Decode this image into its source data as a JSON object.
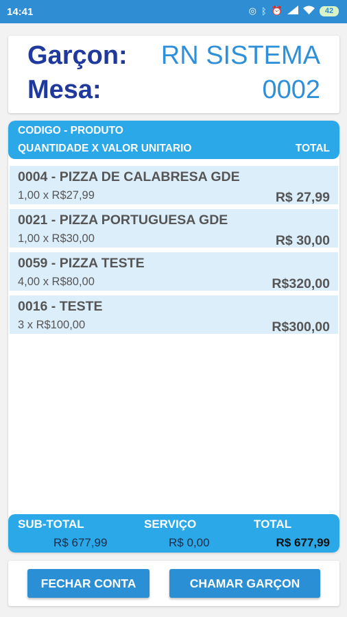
{
  "status_bar": {
    "time": "14:41",
    "icons": [
      "alarm-icon",
      "bluetooth-icon",
      "clock-icon",
      "signal-icon",
      "wifi-icon"
    ],
    "battery": "42"
  },
  "header": {
    "waiter_label": "Garçon:",
    "waiter_value": "RN SISTEMA",
    "table_label": "Mesa:",
    "table_value": "0002"
  },
  "list_header": {
    "line1": "CODIGO - PRODUTO",
    "line2": "QUANTIDADE X VALOR UNITARIO",
    "total": "TOTAL"
  },
  "items": [
    {
      "name": "0004 - PIZZA DE CALABRESA GDE",
      "qty": "1,00  x  R$27,99",
      "total": "R$ 27,99"
    },
    {
      "name": "0021 - PIZZA PORTUGUESA GDE",
      "qty": "1,00  x  R$30,00",
      "total": "R$ 30,00"
    },
    {
      "name": "0059 - PIZZA TESTE",
      "qty": "4,00  x  R$80,00",
      "total": "R$320,00"
    },
    {
      "name": "0016 - TESTE",
      "qty": "3  x  R$100,00",
      "total": "R$300,00"
    }
  ],
  "totals": {
    "subtotal_label": "SUB-TOTAL",
    "subtotal_value": "R$ 677,99",
    "service_label": "SERVIÇO",
    "service_value": "R$ 0,00",
    "total_label": "TOTAL",
    "total_value": "R$ 677,99"
  },
  "buttons": {
    "close_account": "FECHAR CONTA",
    "call_waiter": "CHAMAR GARÇON"
  },
  "colors": {
    "status_bar": "#2e8dd3",
    "accent": "#2ba8e8",
    "label": "#1f3a9c",
    "value": "#2e90d9",
    "item_bg": "#ddeefb",
    "button": "#2b8fd6"
  }
}
